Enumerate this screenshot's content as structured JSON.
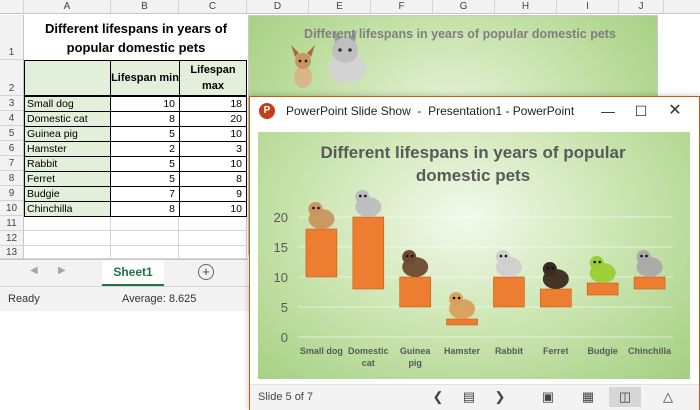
{
  "excel": {
    "columns": [
      "A",
      "B",
      "C",
      "D",
      "E",
      "F",
      "G",
      "H",
      "I",
      "J"
    ],
    "rows": [
      "1",
      "2",
      "3",
      "4",
      "5",
      "6",
      "7",
      "8",
      "9",
      "10",
      "11",
      "12",
      "13"
    ],
    "title": "Different lifespans in years of popular domestic pets",
    "header": {
      "min": "Lifespan min",
      "max": "Lifespan max"
    },
    "data": [
      {
        "pet": "Small dog",
        "min": "10",
        "max": "18"
      },
      {
        "pet": "Domestic cat",
        "min": "8",
        "max": "20"
      },
      {
        "pet": "Guinea pig",
        "min": "5",
        "max": "10"
      },
      {
        "pet": "Hamster",
        "min": "2",
        "max": "3"
      },
      {
        "pet": "Rabbit",
        "min": "5",
        "max": "10"
      },
      {
        "pet": "Ferret",
        "min": "5",
        "max": "8"
      },
      {
        "pet": "Budgie",
        "min": "7",
        "max": "9"
      },
      {
        "pet": "Chinchilla",
        "min": "8",
        "max": "10"
      }
    ],
    "embedded_chart_title": "Different lifespans in years of popular domestic pets",
    "sheet_tab": "Sheet1",
    "status_ready": "Ready",
    "status_average": "Average: 8.625"
  },
  "powerpoint": {
    "window_title": "PowerPoint Slide Show  -  Presentation1 - PowerPoint",
    "slide_counter": "Slide 5 of 7",
    "colors": {
      "accent": "#c43e1c",
      "bar": "#ed7d31"
    }
  },
  "chart_data": {
    "type": "bar",
    "title": "Different lifespans in years of popular domestic pets",
    "categories": [
      "Small dog",
      "Domestic cat",
      "Guinea pig",
      "Hamster",
      "Rabbit",
      "Ferret",
      "Budgie",
      "Chinchilla"
    ],
    "series": [
      {
        "values_min": [
          10,
          8,
          5,
          2,
          5,
          5,
          7,
          8
        ],
        "values_max": [
          18,
          20,
          10,
          3,
          10,
          8,
          9,
          10
        ]
      }
    ],
    "yticks": [
      0,
      5,
      10,
      15,
      20
    ],
    "ylim": [
      0,
      22
    ],
    "grid": true,
    "bar_color": "#ed7d31"
  }
}
